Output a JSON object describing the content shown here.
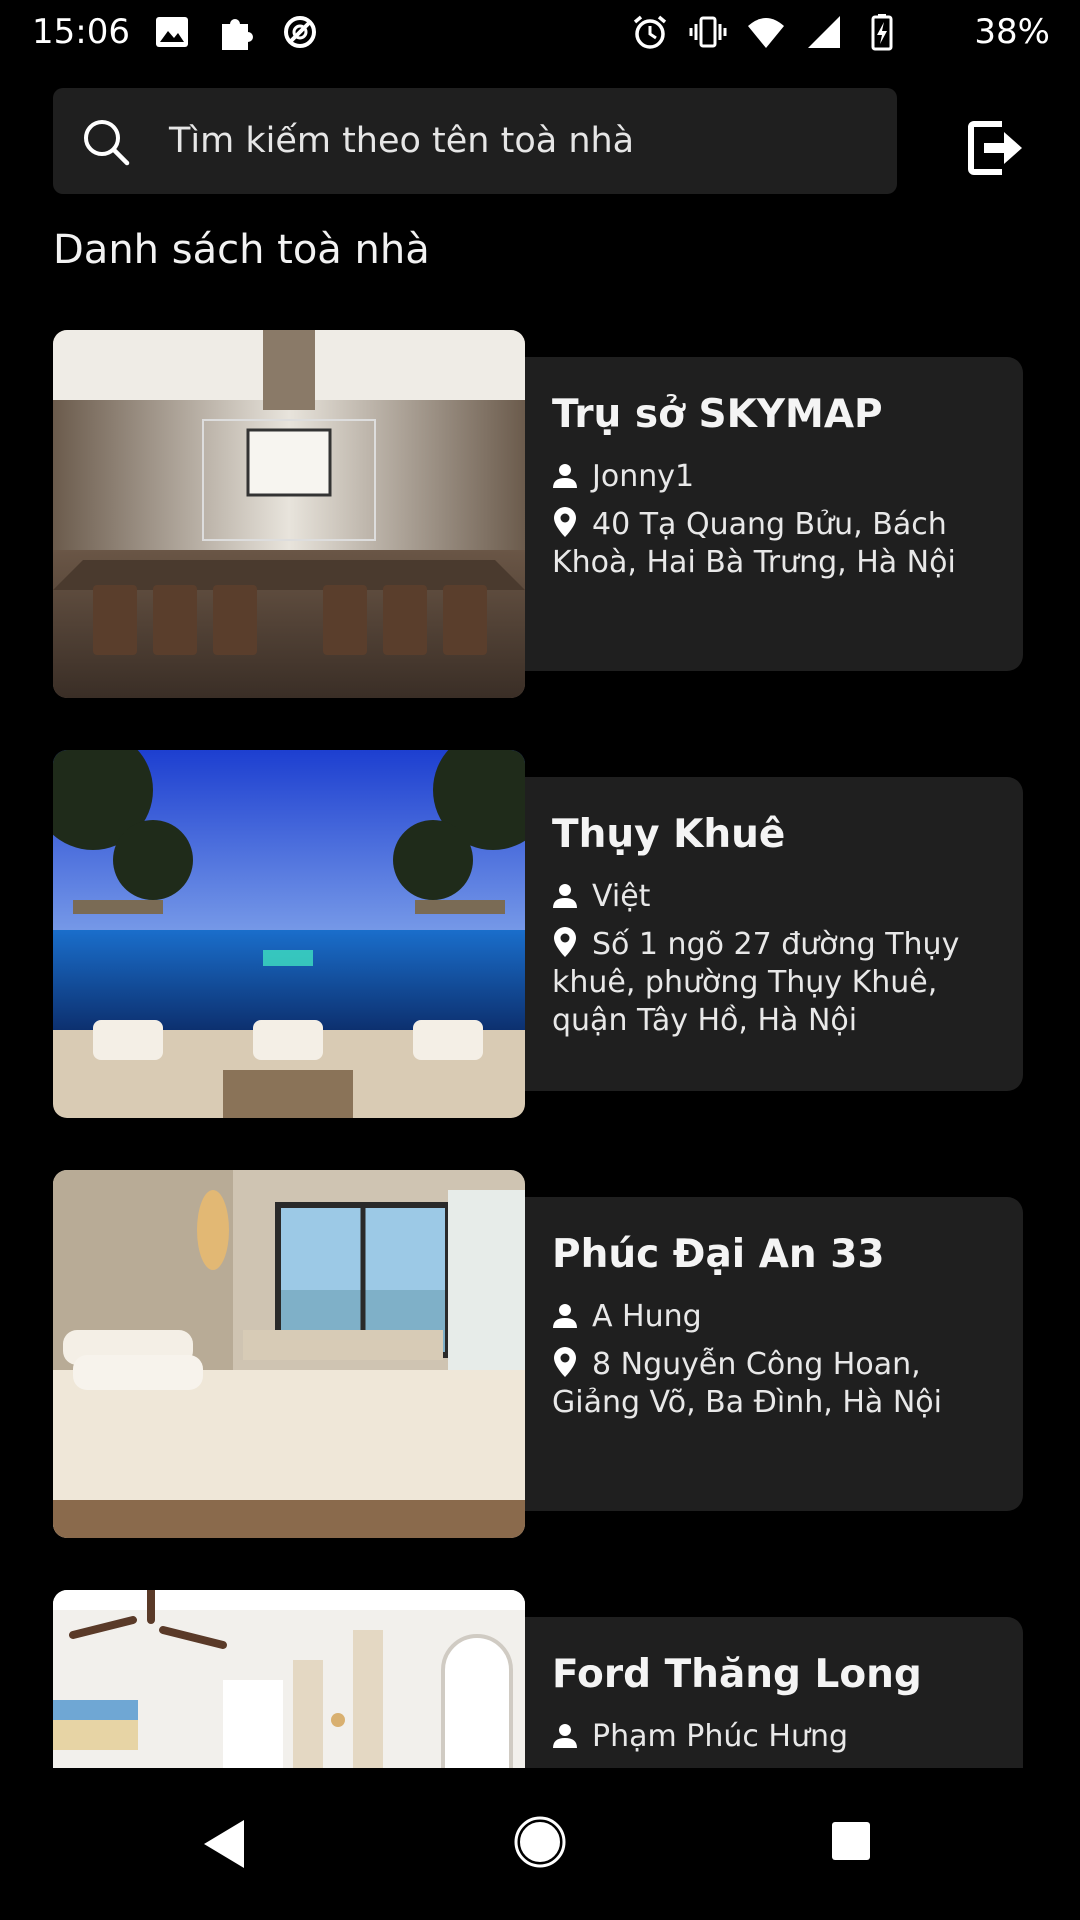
{
  "status_bar": {
    "time": "15:06",
    "battery_percent": "38%",
    "left_icons": [
      "image-icon",
      "puzzle-icon",
      "sync-off-icon"
    ],
    "right_icons": [
      "alarm-icon",
      "vibrate-icon",
      "wifi-icon",
      "signal-icon",
      "battery-charging-icon"
    ]
  },
  "search": {
    "placeholder": "Tìm kiếm theo tên toà nhà"
  },
  "header": {
    "logout_icon": "logout-icon"
  },
  "section": {
    "title": "Danh sách toà nhà"
  },
  "buildings": [
    {
      "name": "Trụ sở SKYMAP",
      "owner": "Jonny1",
      "address": "40 Tạ Quang Bửu, Bách Khoà, Hai Bà Trưng, Hà Nội",
      "image": "conference-room"
    },
    {
      "name": "Thụy Khuê",
      "owner": "Việt",
      "address": "Số 1 ngõ 27 đường  Thụy khuê, phường Thụy Khuê, quận Tây Hồ, Hà Nội",
      "image": "resort-pool"
    },
    {
      "name": "Phúc Đại An 33",
      "owner": "A Hung",
      "address": "8 Nguyễn Công Hoan, Giảng Võ, Ba Đình, Hà Nội",
      "image": "hotel-bedroom"
    },
    {
      "name": "Ford Thăng Long",
      "owner": "Phạm Phúc Hưng",
      "address": "",
      "image": "villa-room"
    }
  ],
  "nav_bar": {
    "icons": [
      "back-icon",
      "home-icon",
      "recents-icon"
    ]
  },
  "colors": {
    "background": "#000000",
    "surface": "#1f1f1f",
    "text": "#ffffff"
  }
}
